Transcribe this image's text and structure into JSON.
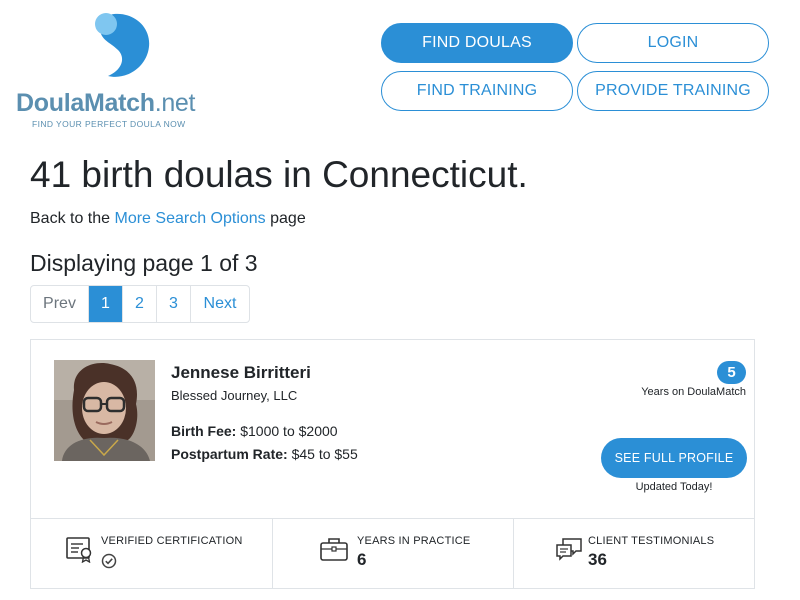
{
  "brand": {
    "name_main": "DoulaMatch",
    "name_suffix": ".net",
    "tagline": "FIND YOUR PERFECT DOULA NOW"
  },
  "nav": {
    "find_doulas": "FIND DOULAS",
    "login": "LOGIN",
    "find_training": "FIND TRAINING",
    "provide_training": "PROVIDE TRAINING"
  },
  "page": {
    "title": "41 birth doulas in Connecticut.",
    "back_prefix": "Back to the ",
    "back_link": "More Search Options",
    "back_suffix": " page",
    "status": "Displaying page 1 of 3"
  },
  "pagination": {
    "prev": "Prev",
    "pages": [
      "1",
      "2",
      "3"
    ],
    "current": "1",
    "next": "Next"
  },
  "listing": {
    "name": "Jennese Birritteri",
    "company": "Blessed Journey, LLC",
    "birth_fee_label": "Birth Fee:",
    "birth_fee_value": " $1000 to $2000",
    "postpartum_label": "Postpartum Rate:",
    "postpartum_value": " $45 to $55",
    "years_on_site": "5",
    "years_caption": "Years on DoulaMatch",
    "profile_button": "SEE FULL PROFILE",
    "updated": "Updated Today!",
    "stats": {
      "certification_label": "VERIFIED CERTIFICATION",
      "years_label": "YEARS IN PRACTICE",
      "years_value": "6",
      "testimonials_label": "CLIENT TESTIMONIALS",
      "testimonials_value": "36"
    }
  },
  "colors": {
    "accent": "#2b8fd6",
    "logo": "#5b8fb0",
    "text": "#212529",
    "border": "#dfe3e7"
  },
  "icons": {
    "logo": "doulamatch-logo-icon",
    "certificate": "certificate-icon",
    "check": "check-circle-icon",
    "briefcase": "briefcase-icon",
    "chat": "chat-bubbles-icon"
  }
}
